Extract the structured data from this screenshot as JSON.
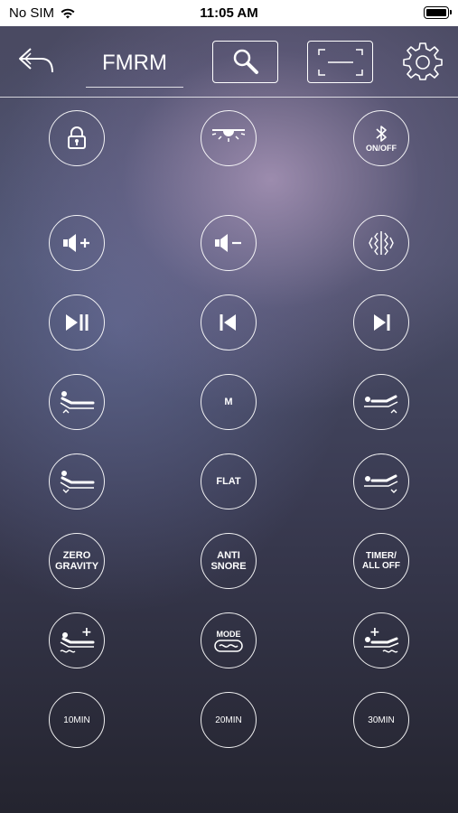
{
  "status": {
    "carrier": "No SIM",
    "time": "11:05 AM",
    "wifi_icon": "wifi-icon",
    "battery_icon": "battery-full-icon"
  },
  "toolbar": {
    "title": "FMRM",
    "back_icon": "back-arrow-icon",
    "search_icon": "search-icon",
    "scan_icon": "scan-icon",
    "settings_icon": "gear-icon"
  },
  "buttons": {
    "lock": {
      "icon": "lock-icon"
    },
    "light": {
      "icon": "under-bed-light-icon"
    },
    "bluetooth": {
      "icon": "bluetooth-icon",
      "label": "ON/OFF"
    },
    "vol_up": {
      "icon": "volume-up-icon"
    },
    "vol_down": {
      "icon": "volume-down-icon"
    },
    "vibration": {
      "icon": "vibration-icon"
    },
    "play_pause": {
      "icon": "play-pause-icon"
    },
    "prev": {
      "icon": "previous-track-icon"
    },
    "next": {
      "icon": "next-track-icon"
    },
    "head_up": {
      "icon": "head-up-icon"
    },
    "memory": {
      "label": "M"
    },
    "foot_up": {
      "icon": "foot-up-icon"
    },
    "head_down": {
      "icon": "head-down-icon"
    },
    "flat": {
      "label": "FLAT"
    },
    "foot_down": {
      "icon": "foot-down-icon"
    },
    "zero_gravity": {
      "label": "ZERO\nGRAVITY"
    },
    "anti_snore": {
      "label": "ANTI\nSNORE"
    },
    "timer": {
      "label": "TIMER/\nALL OFF"
    },
    "head_massage": {
      "icon": "head-massage-plus-icon",
      "label": "+"
    },
    "mode": {
      "icon": "massage-wave-icon",
      "label": "MODE"
    },
    "foot_massage": {
      "icon": "foot-massage-plus-icon",
      "label": "+"
    },
    "t10": {
      "label": "10MIN"
    },
    "t20": {
      "label": "20MIN"
    },
    "t30": {
      "label": "30MIN"
    }
  }
}
